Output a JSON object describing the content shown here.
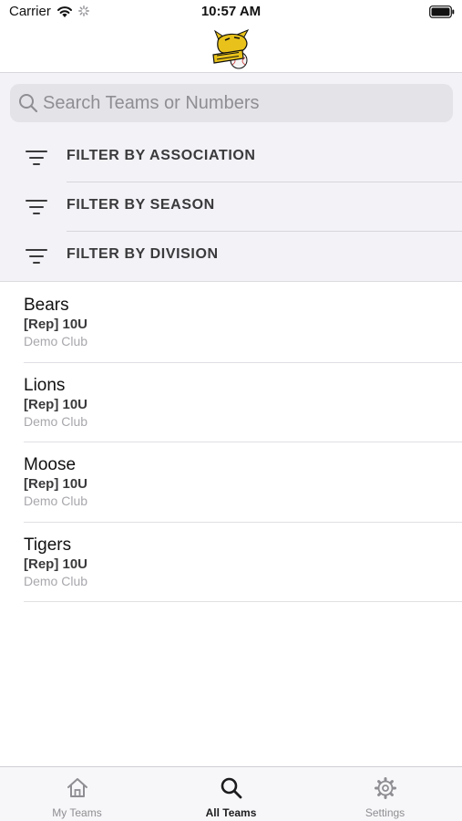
{
  "status_bar": {
    "carrier": "Carrier",
    "time": "10:57 AM"
  },
  "header": {
    "logo_icon": "team-mascot-logo-icon",
    "accent_color": "#e8c21a"
  },
  "search": {
    "placeholder": "Search Teams or Numbers",
    "value": ""
  },
  "filters": [
    {
      "label": "FILTER BY ASSOCIATION",
      "icon": "filter-icon"
    },
    {
      "label": "FILTER BY SEASON",
      "icon": "filter-icon"
    },
    {
      "label": "FILTER BY DIVISION",
      "icon": "filter-icon"
    }
  ],
  "teams": [
    {
      "name": "Bears",
      "division": "[Rep] 10U",
      "club": "Demo Club"
    },
    {
      "name": "Lions",
      "division": "[Rep] 10U",
      "club": "Demo Club"
    },
    {
      "name": "Moose",
      "division": "[Rep] 10U",
      "club": "Demo Club"
    },
    {
      "name": "Tigers",
      "division": "[Rep] 10U",
      "club": "Demo Club"
    }
  ],
  "tab_bar": {
    "tabs": [
      {
        "label": "My Teams",
        "icon": "home-icon",
        "active": false
      },
      {
        "label": "All Teams",
        "icon": "search-icon",
        "active": true
      },
      {
        "label": "Settings",
        "icon": "gear-icon",
        "active": false
      }
    ]
  }
}
